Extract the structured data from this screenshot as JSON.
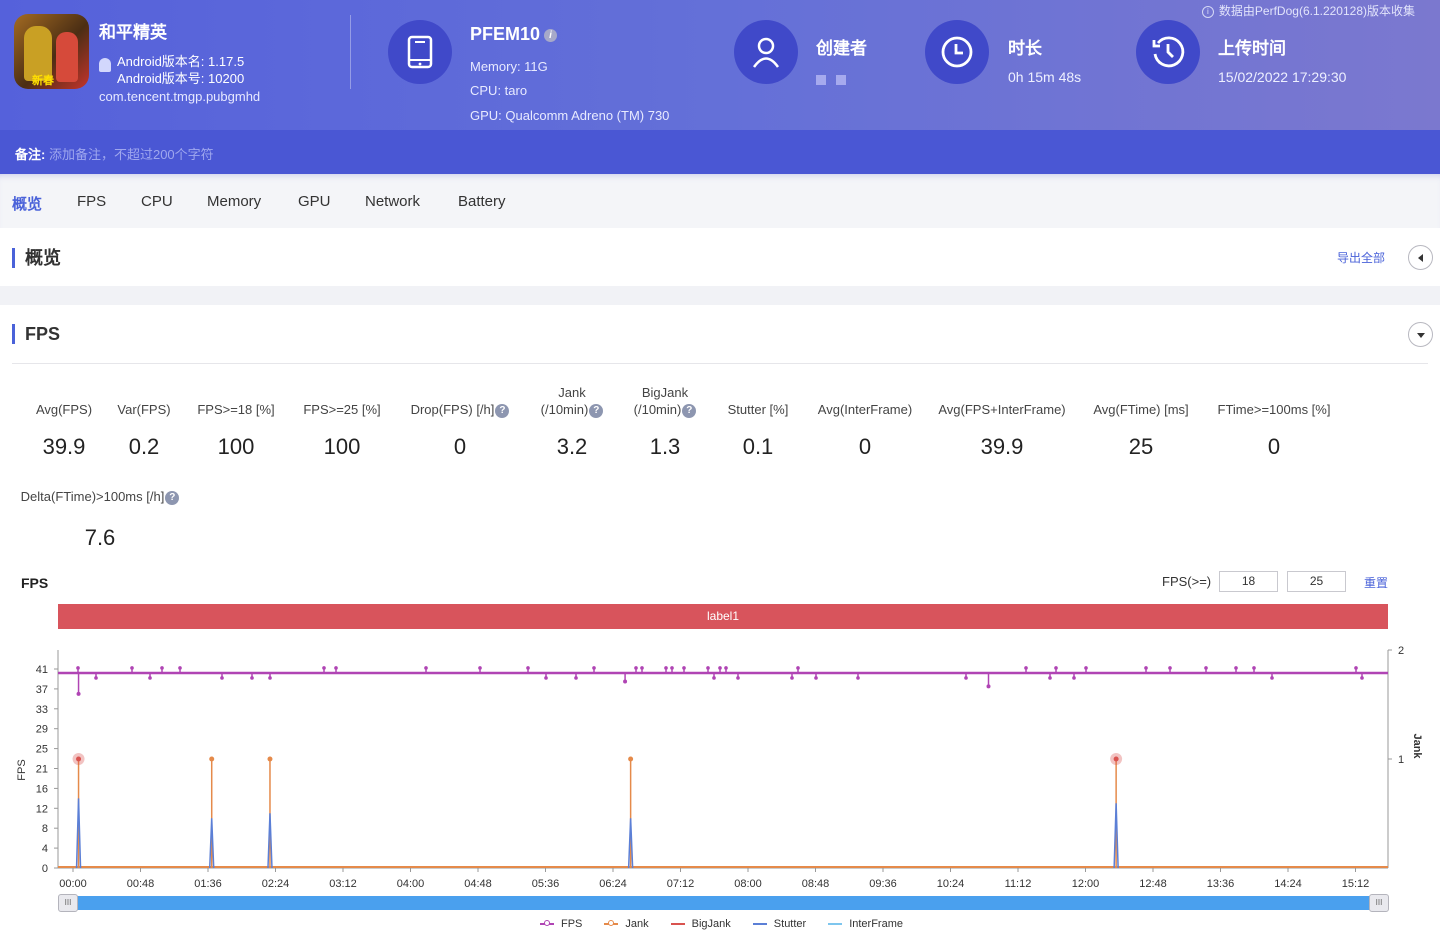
{
  "app": {
    "name": "和平精英",
    "icon_badge": "新春",
    "version_name": "Android版本名: 1.17.5",
    "version_code": "Android版本号: 10200",
    "package": "com.tencent.tmgp.pubgmhd"
  },
  "device": {
    "model": "PFEM10",
    "info_icon": "i",
    "memory": "Memory: 11G",
    "cpu": "CPU: taro",
    "gpu": "GPU: Qualcomm Adreno (TM) 730"
  },
  "creator": {
    "title": "创建者"
  },
  "duration": {
    "title": "时长",
    "value": "0h 15m 48s"
  },
  "upload": {
    "title": "上传时间",
    "value": "15/02/2022 17:29:30"
  },
  "collect_note": "数据由PerfDog(6.1.220128)版本收集",
  "notes": {
    "label": "备注:",
    "placeholder": "添加备注，不超过200个字符"
  },
  "tabs": [
    {
      "label": "概览",
      "active": true
    },
    {
      "label": "FPS"
    },
    {
      "label": "CPU"
    },
    {
      "label": "Memory"
    },
    {
      "label": "GPU"
    },
    {
      "label": "Network"
    },
    {
      "label": "Battery"
    }
  ],
  "overview": {
    "title": "概览",
    "export_label": "导出全部"
  },
  "fps_section": {
    "title": "FPS",
    "metrics": [
      {
        "label": "Avg(FPS)",
        "value": "39.9"
      },
      {
        "label": "Var(FPS)",
        "value": "0.2"
      },
      {
        "label": "FPS>=18 [%]",
        "value": "100"
      },
      {
        "label": "FPS>=25 [%]",
        "value": "100"
      },
      {
        "label": "Drop(FPS) [/h]",
        "value": "0",
        "help": true
      },
      {
        "label": "Jank",
        "label2": "(/10min)",
        "value": "3.2",
        "help": true
      },
      {
        "label": "BigJank",
        "label2": "(/10min)",
        "value": "1.3",
        "help": true
      },
      {
        "label": "Stutter [%]",
        "value": "0.1"
      },
      {
        "label": "Avg(InterFrame)",
        "value": "0"
      },
      {
        "label": "Avg(FPS+InterFrame)",
        "value": "39.9"
      },
      {
        "label": "Avg(FTime) [ms]",
        "value": "25"
      },
      {
        "label": "FTime>=100ms [%]",
        "value": "0"
      },
      {
        "label": "Delta(FTime)>100ms [/h]",
        "value": "7.6",
        "help": true
      }
    ],
    "help_glyph": "?"
  },
  "chart_controls": {
    "title": "FPS",
    "threshold_label": "FPS(>=)",
    "threshold1": "18",
    "threshold2": "25",
    "reset_label": "重置",
    "band_label": "label1",
    "slider_handle": "III"
  },
  "colors": {
    "accent": "#4a62d9",
    "fps": "#b044b4",
    "jank": "#e58a4a",
    "bigjank": "#d9534f",
    "stutter": "#5b7fd6",
    "interframe": "#7ec6ee",
    "band": "#d8545c"
  },
  "chart_data": {
    "type": "line",
    "title": "FPS",
    "xlabel": "",
    "ylabel": "FPS",
    "y2label": "Jank",
    "ylim": [
      0,
      41
    ],
    "y2lim": [
      0,
      2
    ],
    "y_ticks": [
      0,
      4,
      8,
      12,
      16,
      21,
      25,
      29,
      33,
      37,
      41
    ],
    "y2_ticks": [
      1,
      2
    ],
    "x_ticks": [
      "00:00",
      "00:48",
      "01:36",
      "02:24",
      "03:12",
      "04:00",
      "04:48",
      "05:36",
      "06:24",
      "07:12",
      "08:00",
      "08:48",
      "09:36",
      "10:24",
      "11:12",
      "12:00",
      "12:48",
      "13:36",
      "14:24",
      "15:12"
    ],
    "x_range_seconds": [
      0,
      948
    ],
    "legend": [
      "FPS",
      "Jank",
      "BigJank",
      "Stutter",
      "InterFrame"
    ],
    "legend_position": "bottom",
    "fps_baseline": 40,
    "fps_dips": [
      {
        "t": 4,
        "v": 36
      },
      {
        "t": 660,
        "v": 37.5
      },
      {
        "t": 398,
        "v": 38.5
      }
    ],
    "jank_events": [
      {
        "t": 4,
        "jank": 1,
        "bigjank": 1,
        "stutter_fps": 14
      },
      {
        "t": 100,
        "jank": 1,
        "bigjank": 0,
        "stutter_fps": 10
      },
      {
        "t": 142,
        "jank": 1,
        "bigjank": 0,
        "stutter_fps": 11
      },
      {
        "t": 402,
        "jank": 1,
        "bigjank": 0,
        "stutter_fps": 10
      },
      {
        "t": 752,
        "jank": 1,
        "bigjank": 1,
        "stutter_fps": 13
      }
    ]
  }
}
